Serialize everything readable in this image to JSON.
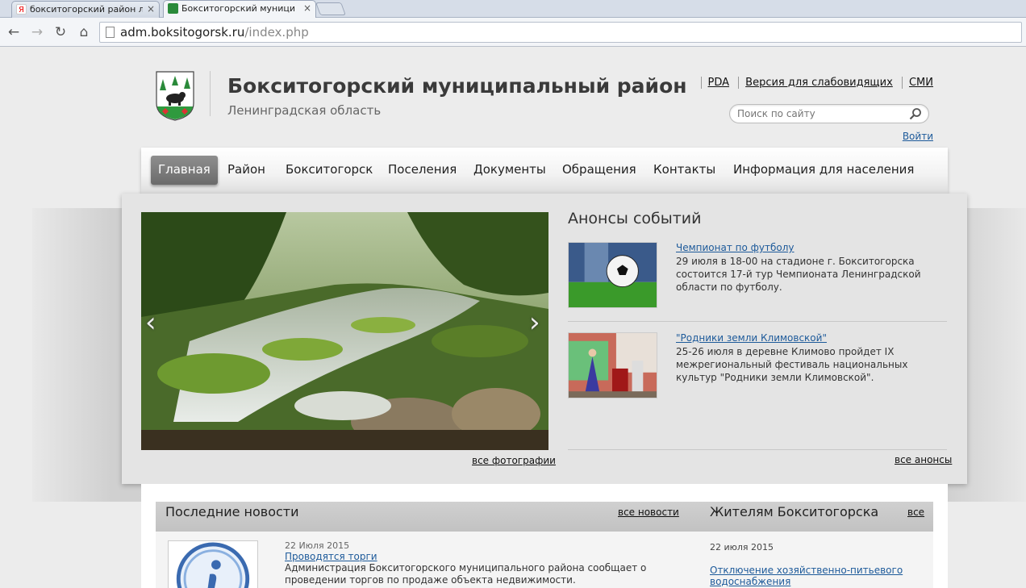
{
  "browser": {
    "tabs": [
      {
        "title": "бокситогорский район лени",
        "active": false,
        "favicon": "yandex-icon",
        "favicon_letter": "Я"
      },
      {
        "title": "Бокситогорский муниципал",
        "active": true,
        "favicon": "coat-of-arms-icon"
      }
    ],
    "url_domain": "adm.boksitogorsk.ru",
    "url_path": "/index.php"
  },
  "header": {
    "title": "Бокситогорский муниципальный район",
    "subtitle": "Ленинградская область",
    "links": [
      "PDA",
      "Версия для слабовидящих",
      "СМИ"
    ],
    "search_placeholder": "Поиск по сайту",
    "login": "Войти"
  },
  "menu": [
    "Главная",
    "Район",
    "Бокситогорск",
    "Поселения",
    "Документы",
    "Обращения",
    "Контакты",
    "Информация для населения"
  ],
  "slider": {
    "all_photos": "все фотографии",
    "prev": "‹",
    "next": "›"
  },
  "events": {
    "title": "Анонсы событий",
    "items": [
      {
        "title": "Чемпионат по футболу",
        "desc": "29 июля в 18-00 на стадионе г. Бокситогорска состоится 17-й тур Чемпионата Ленинградской области по футболу."
      },
      {
        "title": "\"Родники земли Климовской\"",
        "desc": "25-26 июля в деревне Климово пройдет IX межрегиональный фестиваль национальных культур \"Родники земли Климовской\"."
      }
    ],
    "all": "все анонсы"
  },
  "news": {
    "title": "Последние новости",
    "all": "все новости",
    "items": [
      {
        "date": "22 Июля 2015",
        "title": "Проводятся торги",
        "text": "Администрация Бокситогорского муниципального района сообщает о проведении торгов по продаже объекта недвижимости."
      }
    ]
  },
  "residents": {
    "title": "Жителям Бокситогорска",
    "all": "все",
    "items": [
      {
        "date": "22 июля 2015",
        "title": "Отключение хозяйственно-питьевого водоснабжения"
      }
    ]
  },
  "colors": {
    "link": "#1d5a9a",
    "menu_active": "#7a7a7a",
    "panel": "#e4e4e4"
  }
}
